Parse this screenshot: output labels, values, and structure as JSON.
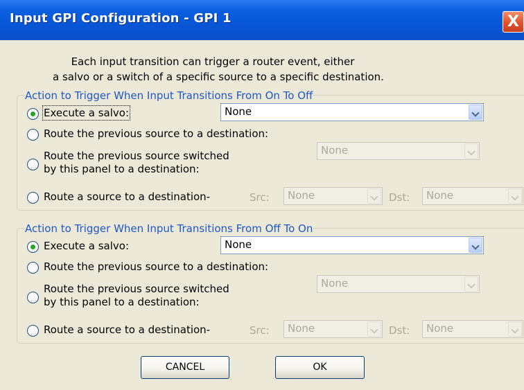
{
  "window": {
    "title": "Input GPI Configuration - GPI 1",
    "close_glyph": "X"
  },
  "intro": {
    "line1": "Each input transition can trigger a router event, either",
    "line2": "a salvo or a switch of a specific source to a specific destination."
  },
  "groups": [
    {
      "legend": "Action to Trigger When Input Transitions From On To Off",
      "salvo_label": "Execute a salvo:",
      "salvo_value": "None",
      "prev_source_label": "Route the previous source to a destination:",
      "panel_source_line1": "Route the previous source switched",
      "panel_source_line2": "by this panel to a destination:",
      "panel_dest_value": "None",
      "route_label": "Route a source to a destination-",
      "src_label": "Src:",
      "src_value": "None",
      "dst_label": "Dst:",
      "dst_value": "None",
      "selected": "salvo"
    },
    {
      "legend": "Action to Trigger When Input Transitions From Off To On",
      "salvo_label": "Execute a salvo:",
      "salvo_value": "None",
      "prev_source_label": "Route the previous source to a destination:",
      "panel_source_line1": "Route the previous source switched",
      "panel_source_line2": "by this panel to a destination:",
      "panel_dest_value": "None",
      "route_label": "Route a source to a destination-",
      "src_label": "Src:",
      "src_value": "None",
      "dst_label": "Dst:",
      "dst_value": "None",
      "selected": "salvo"
    }
  ],
  "buttons": {
    "cancel": "CANCEL",
    "ok": "OK"
  },
  "colors": {
    "titlebar": "#0754d3",
    "dialog_bg": "#ECE9D8",
    "group_legend": "#1f57c4",
    "close_button": "#e0512a",
    "radio_dot": "#2aa02a"
  }
}
